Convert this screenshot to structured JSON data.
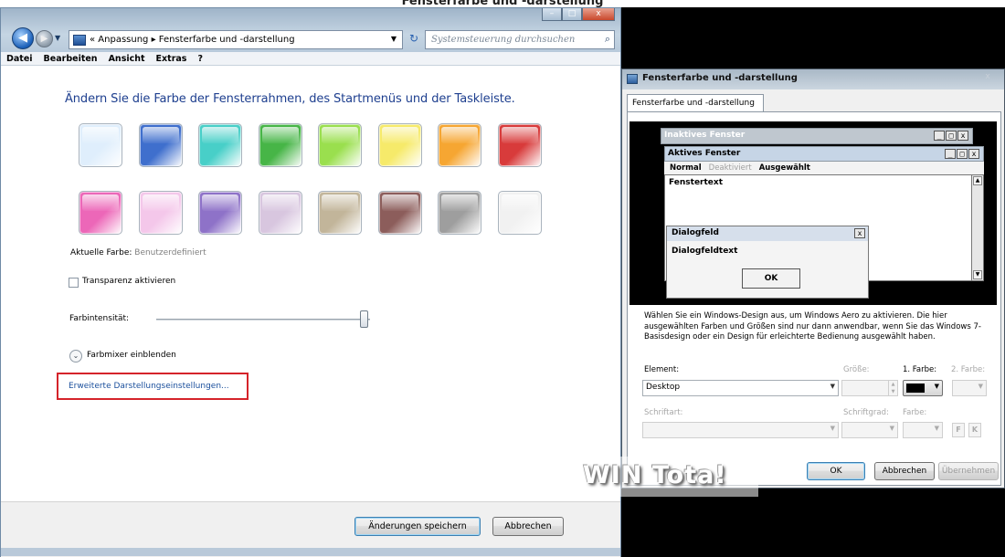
{
  "top_caption": "Fensterfarbe und -darstellung",
  "left_window": {
    "breadcrumb": "« Anpassung ▸ Fensterfarbe und -darstellung",
    "search_placeholder": "Systemsteuerung durchsuchen",
    "menu": [
      "Datei",
      "Bearbeiten",
      "Ansicht",
      "Extras",
      "?"
    ],
    "heading": "Ändern Sie die Farbe der Fensterrahmen, des Startmenüs und der Taskleiste.",
    "swatches": [
      [
        "#dfeefc",
        "#3f6fcd",
        "#48cfc8",
        "#47b547",
        "#9adf4e",
        "#f6ea6a",
        "#f6a632",
        "#d83b3b"
      ],
      [
        "#ec67b8",
        "#f4c7ea",
        "#8e72c8",
        "#d8c6df",
        "#c2b59a",
        "#8c5d5b",
        "#9e9e9e",
        "#f1f1f1"
      ]
    ],
    "current_color_label": "Aktuelle Farbe:",
    "current_color_value": "Benutzerdefiniert",
    "transparency_label": "Transparenz aktivieren",
    "transparency_checked": false,
    "intensity_label": "Farbintensität:",
    "intensity_level": 0.97,
    "mixer_label": "Farbmixer einblenden",
    "advanced_link": "Erweiterte Darstellungseinstellungen...",
    "save_button": "Änderungen speichern",
    "cancel_button": "Abbrechen"
  },
  "dialog": {
    "title": "Fensterfarbe und -darstellung",
    "close_glyph": "x",
    "tab": "Fensterfarbe und -darstellung",
    "preview": {
      "inactive_title": "Inaktives Fenster",
      "active_title": "Aktives Fenster",
      "menu_normal": "Normal",
      "menu_disabled": "Deaktiviert",
      "menu_selected": "Ausgewählt",
      "window_text": "Fenstertext",
      "dialog_title": "Dialogfeld",
      "dialog_text": "Dialogfeldtext",
      "ok": "OK"
    },
    "info_text": "Wählen Sie ein Windows-Design aus, um Windows Aero zu aktivieren. Die hier ausgewählten Farben und Größen sind nur dann anwendbar, wenn Sie das Windows 7-Basisdesign oder ein Design für erleichterte Bedienung ausgewählt haben.",
    "element_label": "Element:",
    "element_value": "Desktop",
    "size_label": "Größe:",
    "color1_label": "1. Farbe:",
    "color2_label": "2. Farbe:",
    "font_label": "Schriftart:",
    "font_size_label": "Schriftgrad:",
    "font_color_label": "Farbe:",
    "bold_glyph": "F",
    "italic_glyph": "K",
    "ok_button": "OK",
    "cancel_button": "Abbrechen",
    "apply_button": "Übernehmen"
  },
  "watermark": "WIN Tota!"
}
